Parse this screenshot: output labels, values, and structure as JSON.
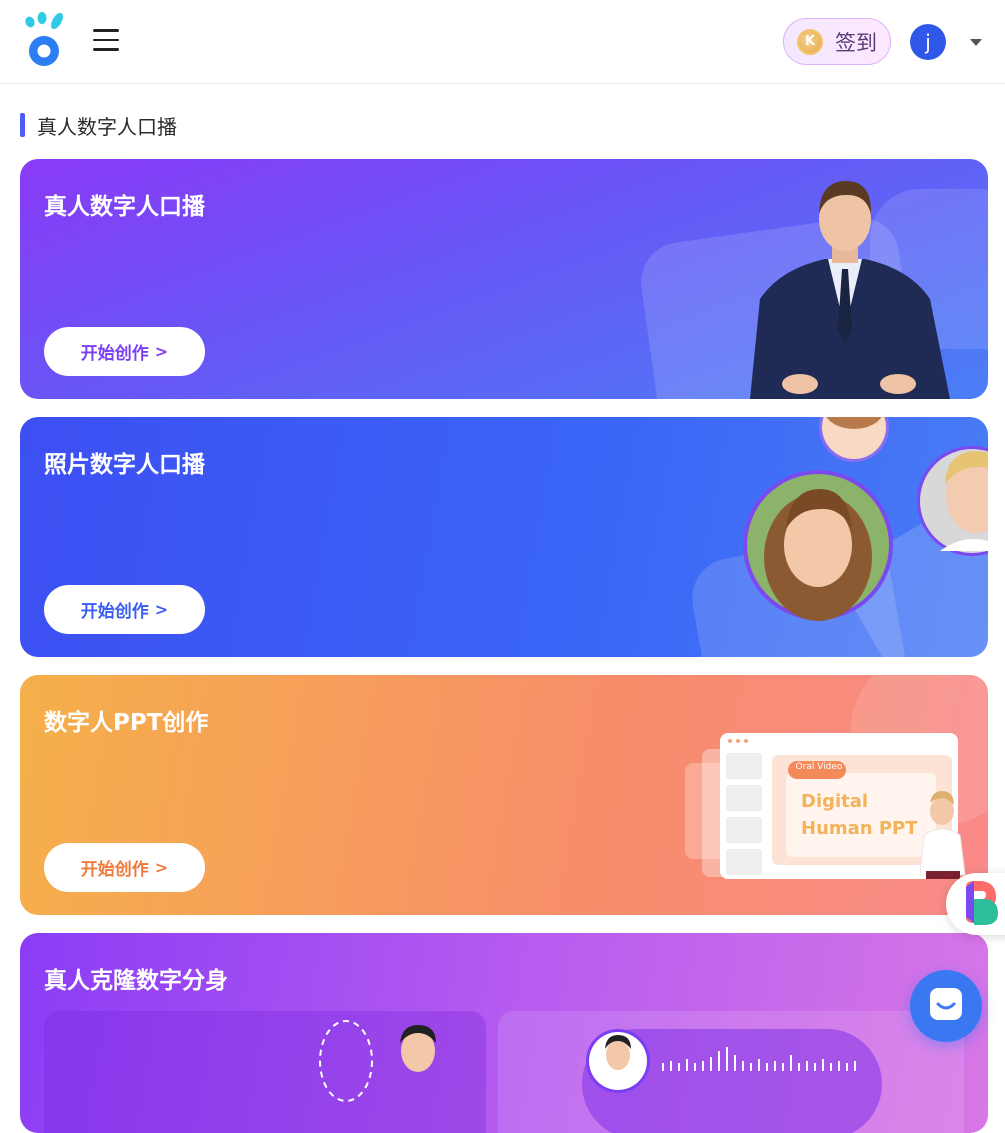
{
  "header": {
    "signin_label": "签到",
    "coin_letter": "K",
    "user_initial": "j"
  },
  "section": {
    "title": "真人数字人口播"
  },
  "cards": [
    {
      "title": "真人数字人口播",
      "button": "开始创作"
    },
    {
      "title": "照片数字人口播",
      "button": "开始创作"
    },
    {
      "title": "数字人PPT创作",
      "button": "开始创作",
      "preview_tag": "Oral Video",
      "preview_line1": "Digital",
      "preview_line2": "Human PPT"
    },
    {
      "title": "真人克隆数字分身"
    }
  ],
  "colors": {
    "accent": "#4f5bf5",
    "chat": "#3a78f2",
    "avatar": "#2f57e8"
  },
  "icons": {
    "menu": "hamburger-icon",
    "caret": "caret-down-icon",
    "chat": "chat-icon",
    "chevron": "chevron-right-icon"
  }
}
